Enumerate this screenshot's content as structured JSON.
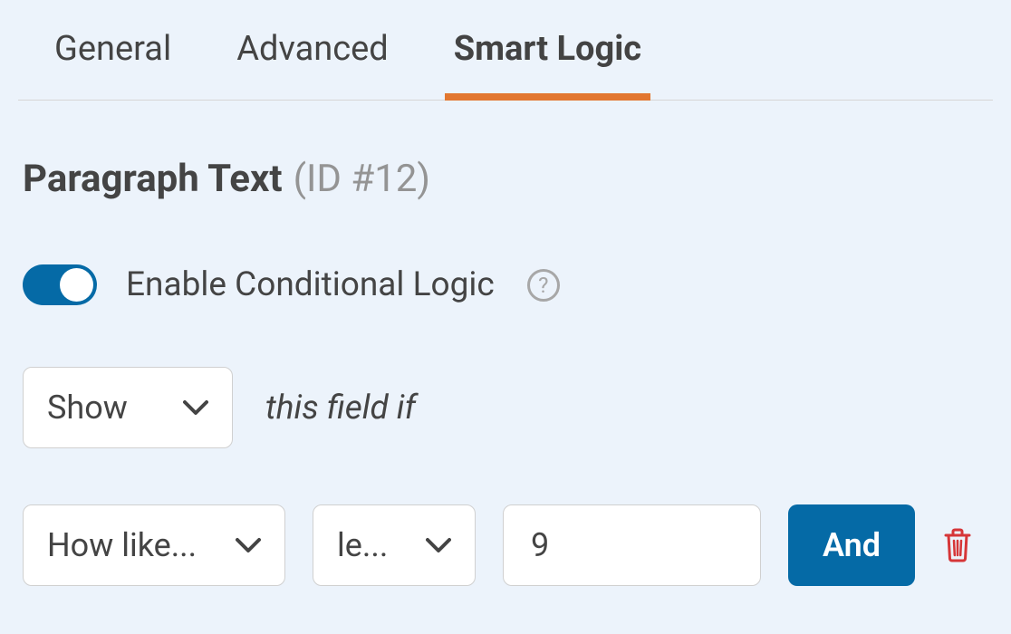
{
  "tabs": {
    "general": "General",
    "advanced": "Advanced",
    "smart_logic": "Smart Logic"
  },
  "heading": {
    "label": "Paragraph Text",
    "id": "(ID #12)"
  },
  "toggle": {
    "label": "Enable Conditional Logic",
    "enabled": true
  },
  "show_rule": {
    "action": "Show",
    "suffix": "this field if"
  },
  "condition": {
    "field": "How like...",
    "operator": "le...",
    "value": "9",
    "conjunction": "And"
  }
}
